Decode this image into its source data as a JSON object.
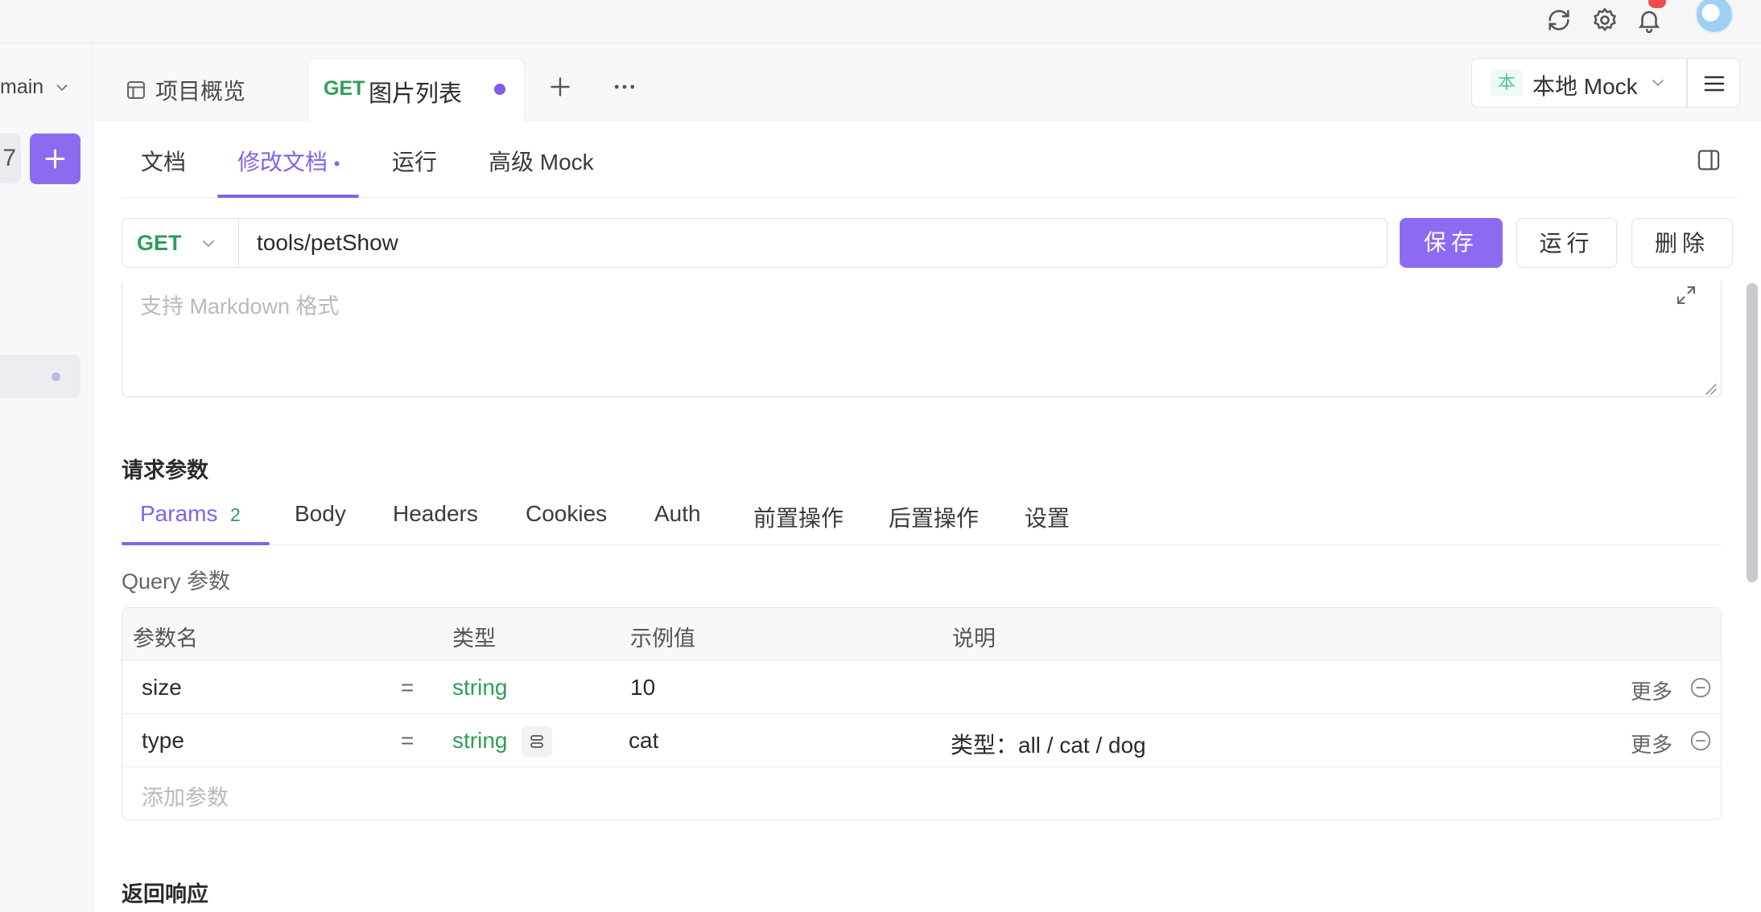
{
  "top": {
    "icons": [
      "refresh-icon",
      "settings-icon",
      "bell-icon"
    ],
    "avatar": "avatar"
  },
  "sidebar": {
    "branch": "main",
    "box_char": "7",
    "add_icon": "plus-icon"
  },
  "tabs": [
    {
      "label": "项目概览",
      "icon": "layout-icon"
    },
    {
      "method": "GET",
      "label": "图片列表",
      "unsaved": true
    }
  ],
  "environment": {
    "badge": "本",
    "label": "本地 Mock"
  },
  "subtabs": {
    "doc": "文档",
    "edit": "修改文档",
    "run": "运行",
    "mock": "高级 Mock",
    "edit_marker": "•"
  },
  "request": {
    "method": "GET",
    "url": "tools/petShow",
    "save_label": "保存",
    "run_label": "运行",
    "delete_label": "删除"
  },
  "description": {
    "placeholder": "支持 Markdown 格式"
  },
  "params_section": {
    "title": "请求参数",
    "tabs": {
      "params": "Params",
      "params_count": "2",
      "body": "Body",
      "headers": "Headers",
      "cookies": "Cookies",
      "auth": "Auth",
      "pre": "前置操作",
      "post": "后置操作",
      "settings": "设置"
    },
    "query_label": "Query 参数",
    "columns": {
      "name": "参数名",
      "type": "类型",
      "example": "示例值",
      "desc": "说明"
    },
    "rows": [
      {
        "name": "size",
        "eq": "=",
        "type": "string",
        "example": "10",
        "desc": "",
        "more": "更多"
      },
      {
        "name": "type",
        "eq": "=",
        "type": "string",
        "example": "cat",
        "desc": "类型：all / cat / dog",
        "more": "更多"
      }
    ],
    "add_placeholder": "添加参数"
  },
  "response_section": {
    "title": "返回响应"
  },
  "colors": {
    "accent": "#8b6cf0",
    "get_green": "#2f9e59",
    "badge_red": "#f04a4a"
  }
}
